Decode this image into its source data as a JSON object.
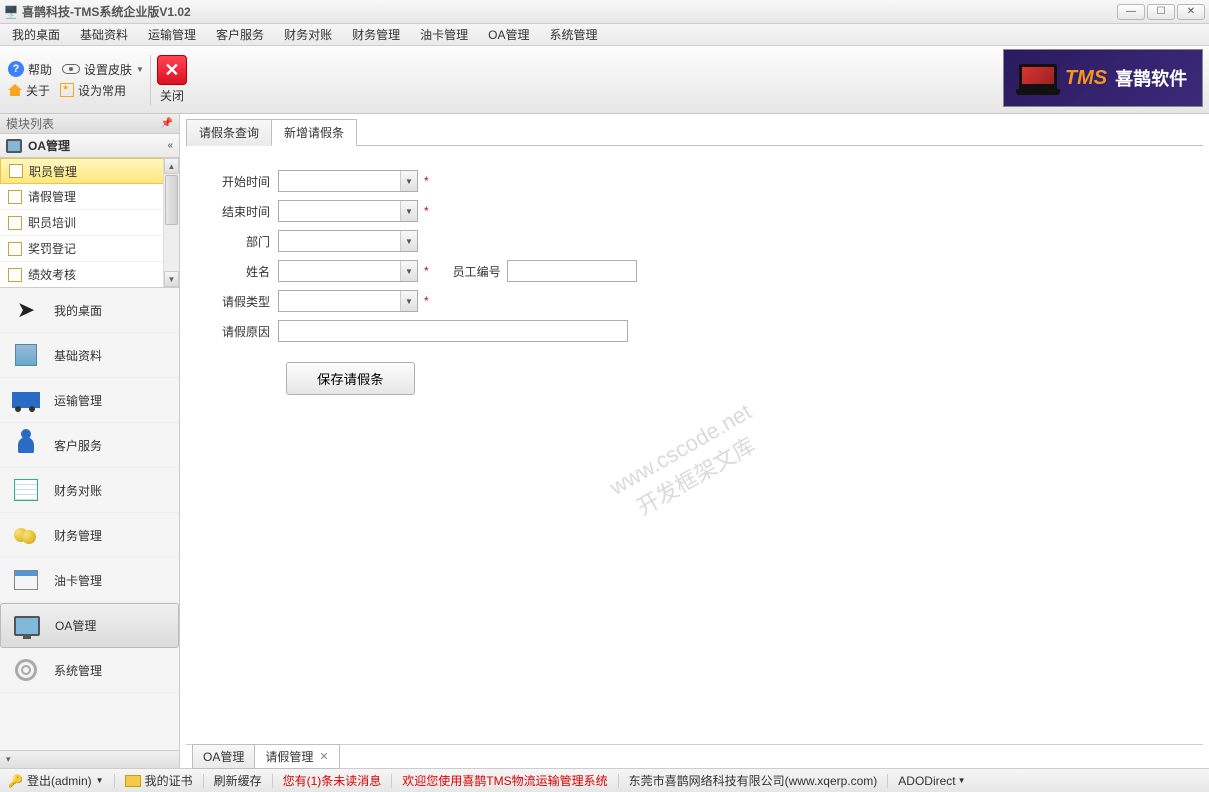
{
  "title": "喜鹊科技-TMS系统企业版V1.02",
  "menubar": [
    "我的桌面",
    "基础资料",
    "运输管理",
    "客户服务",
    "财务对账",
    "财务管理",
    "油卡管理",
    "OA管理",
    "系统管理"
  ],
  "toolbar": {
    "help": "帮助",
    "skin": "设置皮肤",
    "about": "关于",
    "fav": "设为常用",
    "close": "关闭"
  },
  "brand": {
    "tms": "TMS",
    "txt": "喜鹊软件"
  },
  "sidebar": {
    "header": "模块列表",
    "groupTitle": "OA管理",
    "tree": [
      {
        "label": "职员管理",
        "selected": true
      },
      {
        "label": "请假管理"
      },
      {
        "label": "职员培训"
      },
      {
        "label": "奖罚登记"
      },
      {
        "label": "绩效考核"
      }
    ],
    "nav": [
      {
        "label": "我的桌面",
        "icon": "arrow"
      },
      {
        "label": "基础资料",
        "icon": "book"
      },
      {
        "label": "运输管理",
        "icon": "truck"
      },
      {
        "label": "客户服务",
        "icon": "person"
      },
      {
        "label": "财务对账",
        "icon": "table"
      },
      {
        "label": "财务管理",
        "icon": "coins"
      },
      {
        "label": "油卡管理",
        "icon": "win"
      },
      {
        "label": "OA管理",
        "icon": "screen",
        "active": true
      },
      {
        "label": "系统管理",
        "icon": "gear"
      }
    ]
  },
  "innerTabs": [
    {
      "label": "请假条查询"
    },
    {
      "label": "新增请假条",
      "active": true
    }
  ],
  "form": {
    "start": "开始时间",
    "end": "结束时间",
    "dept": "部门",
    "name": "姓名",
    "empno": "员工编号",
    "type": "请假类型",
    "reason": "请假原因",
    "save": "保存请假条"
  },
  "watermark": {
    "l1": "www.cscode.net",
    "l2": "开发框架文库"
  },
  "bottomTabs": [
    {
      "label": "OA管理"
    },
    {
      "label": "请假管理",
      "active": true
    }
  ],
  "status": {
    "login": "登出(admin)",
    "cert": "我的证书",
    "refresh": "刷新缓存",
    "msg": "您有(1)条未读消息",
    "welcome": "欢迎您使用喜鹊TMS物流运输管理系统",
    "company": "东莞市喜鹊网络科技有限公司(www.xqerp.com)",
    "db": "ADODirect"
  }
}
